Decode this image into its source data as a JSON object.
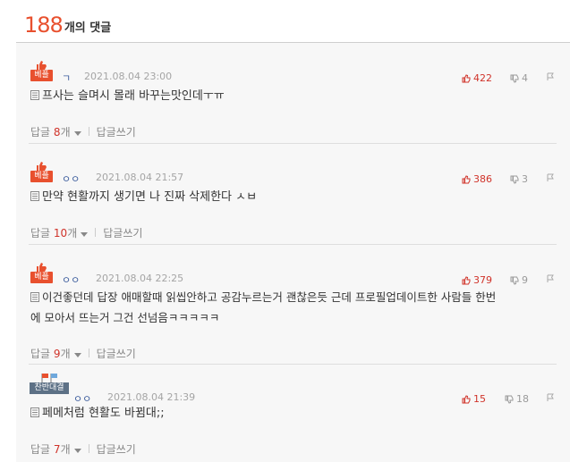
{
  "header": {
    "count": "188",
    "count_label": "개의 댓글"
  },
  "labels": {
    "best_badge": "베플",
    "reply_label": "답글",
    "reply_unit": "개",
    "write_reply": "답글쓰기"
  },
  "comments": [
    {
      "author": "ㄱ",
      "date": "2021.08.04 23:00",
      "likes": "422",
      "dislikes": "4",
      "text": "프사는 슬며시 몰래 바꾸는맛인데ㅜㅠ",
      "replies": "8",
      "badge_type": "best"
    },
    {
      "author": "ㅇㅇ",
      "date": "2021.08.04 21:57",
      "likes": "386",
      "dislikes": "3",
      "text": "만약 현활까지 생기면 나 진짜 삭제한다 ㅅㅂ",
      "replies": "10",
      "badge_type": "best"
    },
    {
      "author": "ㅇㅇ",
      "date": "2021.08.04 22:25",
      "likes": "379",
      "dislikes": "9",
      "text_line1": "이건좋던데 답장 애매할때 읽씹안하고 공감누르는거 괜찮은듯 근데 프로필업데이트한 사람들 한번",
      "text_line2": "에 모아서 뜨는거 그건 선넘음ㅋㅋㅋㅋㅋ",
      "replies": "9",
      "badge_type": "best"
    },
    {
      "author": "ㅇㅇ",
      "date": "2021.08.04 21:39",
      "likes": "15",
      "dislikes": "18",
      "text": "페메처럼 현활도 바뀜대;;",
      "replies": "7",
      "badge_type": "rep",
      "rep_badge": "찬반대결"
    }
  ],
  "colors": {
    "accent": "#e8502e",
    "like": "#d0332a",
    "rep_badge": "#5d7186"
  }
}
